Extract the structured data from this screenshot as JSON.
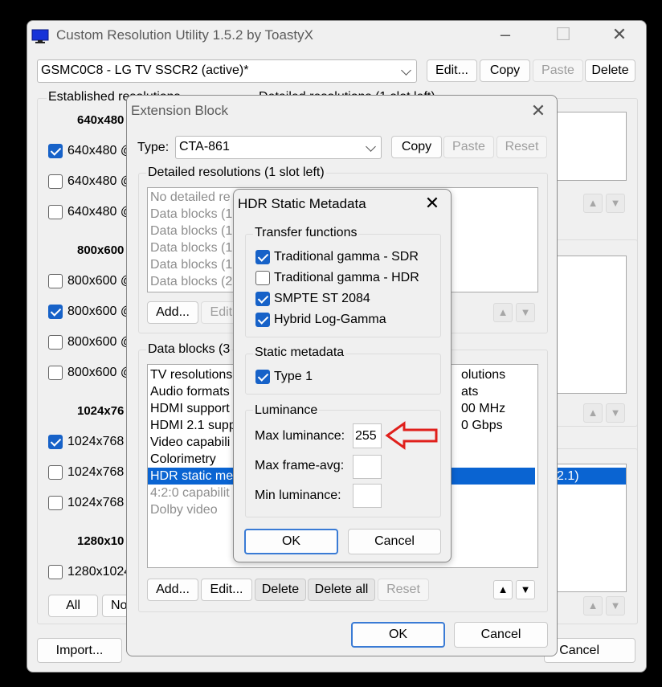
{
  "main": {
    "title": "Custom Resolution Utility 1.5.2 by ToastyX",
    "monitor_select": "GSMC0C8 - LG TV SSCR2 (active)*",
    "buttons": {
      "edit": "Edit...",
      "copy": "Copy",
      "paste": "Paste",
      "delete": "Delete"
    },
    "established_label": "Established resolutions",
    "detailed_label": "Detailed resolutions (1 slot left)",
    "groups": [
      {
        "heading": "640x480",
        "items": [
          {
            "label": "640x480 @",
            "checked": true
          },
          {
            "label": "640x480 @",
            "checked": false
          },
          {
            "label": "640x480 @",
            "checked": false
          }
        ]
      },
      {
        "heading": "800x600",
        "items": [
          {
            "label": "800x600 @",
            "checked": false
          },
          {
            "label": "800x600 @",
            "checked": true
          },
          {
            "label": "800x600 @",
            "checked": false
          },
          {
            "label": "800x600 @",
            "checked": false
          }
        ]
      },
      {
        "heading": "1024x76",
        "items": [
          {
            "label": "1024x768",
            "checked": true
          },
          {
            "label": "1024x768",
            "checked": false
          },
          {
            "label": "1024x768",
            "checked": false
          }
        ]
      },
      {
        "heading": "1280x10",
        "items": [
          {
            "label": "1280x1024",
            "checked": false
          }
        ]
      }
    ],
    "all_button": "All",
    "none_button": "No",
    "import_button": "Import...",
    "cancel_button": "Cancel",
    "right_list_rows": [
      "olutions",
      "ats",
      "00 MHz",
      "0 Gbps"
    ],
    "right_list_selected": "2.1)"
  },
  "ext": {
    "title": "Extension Block",
    "type_label": "Type:",
    "type_value": "CTA-861",
    "copy": "Copy",
    "paste": "Paste",
    "reset": "Reset",
    "detailed_label": "Detailed resolutions (1 slot left)",
    "detailed_rows": [
      "No detailed re",
      "Data blocks (1",
      "Data blocks (1",
      "Data blocks (1",
      "Data blocks (1",
      "Data blocks (2"
    ],
    "add": "Add...",
    "edit": "Edit...",
    "datablocks_label": "Data blocks (3",
    "datablock_rows": [
      "TV resolutions",
      "Audio formats",
      "HDMI support",
      "HDMI 2.1 supp",
      "Video capabili",
      "Colorimetry",
      "HDR static me",
      "4:2:0 capabilit",
      "Dolby video"
    ],
    "db_add": "Add...",
    "db_edit": "Edit...",
    "db_delete": "Delete",
    "db_delete_all": "Delete all",
    "db_reset": "Reset",
    "ok": "OK",
    "cancel": "Cancel"
  },
  "hdr": {
    "title": "HDR Static Metadata",
    "transfer_label": "Transfer functions",
    "transfer": [
      {
        "label": "Traditional gamma - SDR",
        "checked": true
      },
      {
        "label": "Traditional gamma - HDR",
        "checked": false
      },
      {
        "label": "SMPTE ST 2084",
        "checked": true
      },
      {
        "label": "Hybrid Log-Gamma",
        "checked": true
      }
    ],
    "static_label": "Static metadata",
    "type1": {
      "label": "Type 1",
      "checked": true
    },
    "luminance_label": "Luminance",
    "max_lum_label": "Max luminance:",
    "max_lum_value": "255",
    "max_frame_label": "Max frame-avg:",
    "max_frame_value": "",
    "min_lum_label": "Min luminance:",
    "min_lum_value": "",
    "ok": "OK",
    "cancel": "Cancel"
  },
  "colors": {
    "accent": "#1762c8",
    "selection": "#0a64d2",
    "annotation_arrow": "#e0201c"
  }
}
